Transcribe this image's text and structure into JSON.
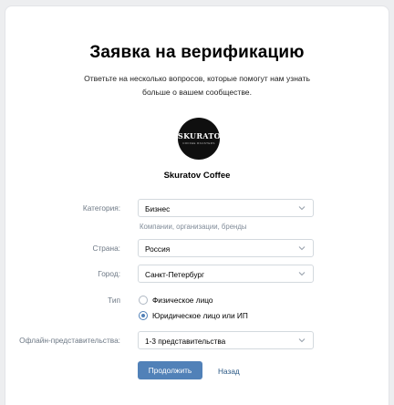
{
  "header": {
    "title": "Заявка на верификацию",
    "subtitle": "Ответьте на несколько вопросов, которые помогут нам узнать больше о вашем сообществе."
  },
  "community": {
    "avatar_text": "SKURATOV",
    "avatar_subtext": "COFFEE ROASTERS",
    "name": "Skuratov Coffee"
  },
  "form": {
    "category": {
      "label": "Категория:",
      "value": "Бизнес",
      "hint": "Компании, организации, бренды"
    },
    "country": {
      "label": "Страна:",
      "value": "Россия"
    },
    "city": {
      "label": "Город:",
      "value": "Санкт-Петербург"
    },
    "type": {
      "label": "Тип",
      "options": [
        {
          "label": "Физическое лицо",
          "selected": false
        },
        {
          "label": "Юридическое лицо или ИП",
          "selected": true
        }
      ]
    },
    "offline": {
      "label": "Офлайн-представительства:",
      "value": "1-3 представительства"
    }
  },
  "actions": {
    "submit_label": "Продолжить",
    "back_label": "Назад"
  },
  "colors": {
    "accent": "#5181b8",
    "link": "#2a5885",
    "border": "#d3d9de",
    "muted": "#6d7885"
  }
}
